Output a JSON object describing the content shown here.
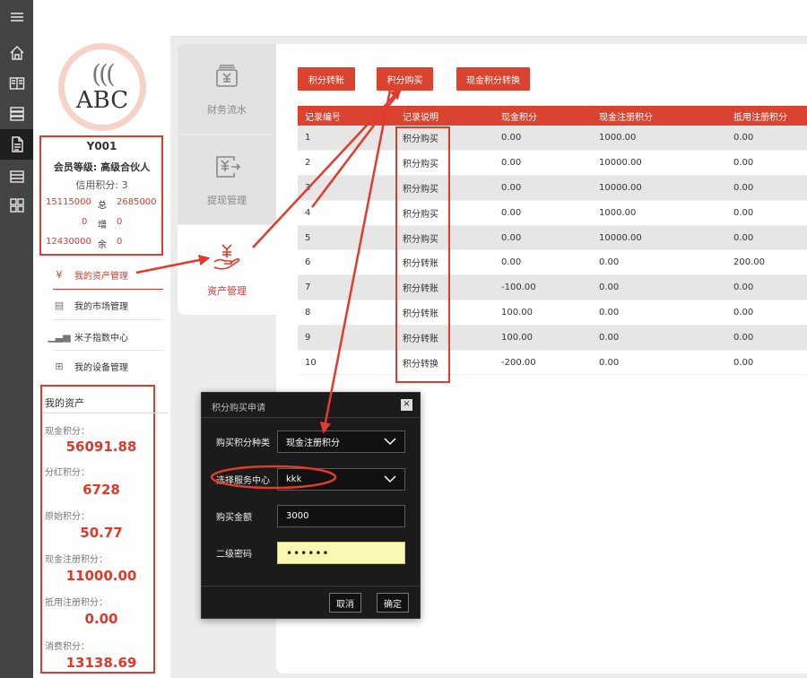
{
  "rail": {
    "icons": [
      "menu-icon",
      "home-icon",
      "columns-icon",
      "list-icon",
      "document-icon",
      "card-icon",
      "grid-icon"
    ]
  },
  "profile": {
    "logo_text": "ABC",
    "user_id": "Y001",
    "level": "会员等级: 高级合伙人",
    "credit": "信用积分: 3",
    "stats": [
      {
        "left": "15115000",
        "mid": "总",
        "right": "2685000"
      },
      {
        "left": "0",
        "mid": "增",
        "right": "0"
      },
      {
        "left": "12430000",
        "mid": "余",
        "right": "0"
      }
    ]
  },
  "menu": [
    {
      "label": "我的资产管理",
      "icon": "hand-coin-icon",
      "active": true
    },
    {
      "label": "我的市场管理",
      "icon": "market-icon",
      "active": false
    },
    {
      "label": "米子指数中心",
      "icon": "chart-icon",
      "active": false
    },
    {
      "label": "我的设备管理",
      "icon": "grid-icon",
      "active": false
    }
  ],
  "assets": {
    "title": "我的资产",
    "items": [
      {
        "label": "现金积分：",
        "value": "56091.88"
      },
      {
        "label": "分红积分：",
        "value": "6728"
      },
      {
        "label": "原始积分：",
        "value": "50.77"
      },
      {
        "label": "现金注册积分：",
        "value": "11000.00"
      },
      {
        "label": "抵用注册积分：",
        "value": "0.00"
      },
      {
        "label": "消费积分：",
        "value": "13138.69"
      }
    ]
  },
  "tabs": [
    {
      "label": "财务流水",
      "icon": "finance-icon"
    },
    {
      "label": "提现管理",
      "icon": "withdraw-icon"
    },
    {
      "label": "资产管理",
      "icon": "asset-icon"
    }
  ],
  "toolbar": {
    "transfer": "积分转账",
    "purchase": "积分购买",
    "convert": "现金积分转换"
  },
  "table": {
    "headers": [
      "记录编号",
      "记录说明",
      "现金积分",
      "现金注册积分",
      "抵用注册积分"
    ],
    "rows": [
      [
        "1",
        "积分购买",
        "0.00",
        "1000.00",
        "0.00"
      ],
      [
        "2",
        "积分购买",
        "0.00",
        "10000.00",
        "0.00"
      ],
      [
        "3",
        "积分购买",
        "0.00",
        "10000.00",
        "0.00"
      ],
      [
        "4",
        "积分购买",
        "0.00",
        "1000.00",
        "0.00"
      ],
      [
        "5",
        "积分购买",
        "0.00",
        "10000.00",
        "0.00"
      ],
      [
        "6",
        "积分转账",
        "0.00",
        "0.00",
        "200.00"
      ],
      [
        "7",
        "积分转账",
        "-100.00",
        "0.00",
        "0.00"
      ],
      [
        "8",
        "积分转账",
        "100.00",
        "0.00",
        "0.00"
      ],
      [
        "9",
        "积分转账",
        "100.00",
        "0.00",
        "0.00"
      ],
      [
        "10",
        "积分转换",
        "-200.00",
        "0.00",
        "0.00"
      ]
    ]
  },
  "modal": {
    "title": "积分购买申请",
    "close": "×",
    "type_label": "购买积分种类",
    "type_value": "现金注册积分",
    "center_label": "选择服务中心",
    "center_value": "kkk",
    "amount_label": "购买金额",
    "amount_value": "3000",
    "password_label": "二级密码",
    "password_value": "••••••",
    "cancel": "取消",
    "confirm": "确定"
  },
  "colors": {
    "accent": "#d9432f",
    "annotation": "#e23b2e"
  }
}
